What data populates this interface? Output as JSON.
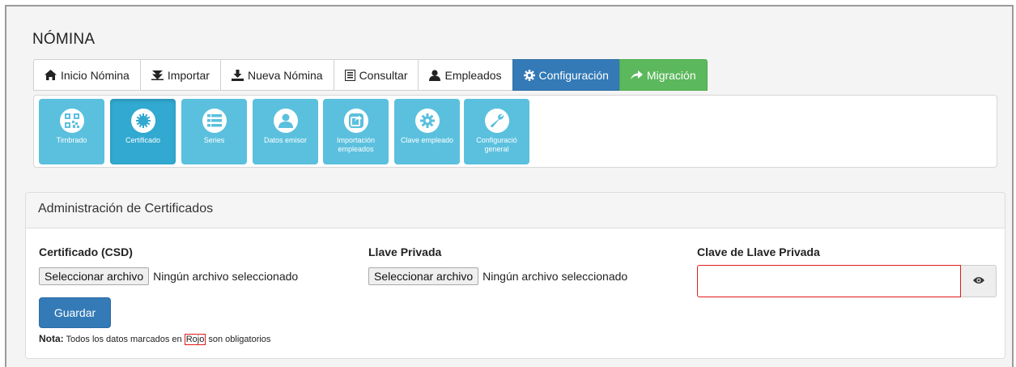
{
  "page": {
    "title": "NÓMINA"
  },
  "tabs": [
    {
      "label": "Inicio Nómina",
      "icon": "home-icon"
    },
    {
      "label": "Importar",
      "icon": "import-icon"
    },
    {
      "label": "Nueva Nómina",
      "icon": "download-icon"
    },
    {
      "label": "Consultar",
      "icon": "list-icon"
    },
    {
      "label": "Empleados",
      "icon": "user-icon"
    },
    {
      "label": "Configuración",
      "icon": "gear-icon",
      "active": true
    },
    {
      "label": "Migración",
      "icon": "arrow-right-icon"
    }
  ],
  "tiles": [
    {
      "label": "Timbrado",
      "icon": "qrcode-icon"
    },
    {
      "label": "Certificado",
      "icon": "certificate-icon",
      "active": true
    },
    {
      "label": "Series",
      "icon": "list-icon"
    },
    {
      "label": "Datos emisor",
      "icon": "user-icon"
    },
    {
      "label": "Importación empleados",
      "icon": "share-icon"
    },
    {
      "label": "Clave empleado",
      "icon": "gear-icon"
    },
    {
      "label": "Configuració general",
      "icon": "wrench-icon"
    }
  ],
  "cert_panel": {
    "heading": "Administración de Certificados",
    "certificado_label": "Certificado (CSD)",
    "llave_label": "Llave Privada",
    "clave_label": "Clave de Llave Privada",
    "file_button": "Seleccionar archivo",
    "no_file": "Ningún archivo seleccionado",
    "password_value": "",
    "save_button": "Guardar",
    "note_label": "Nota:",
    "note_before": "Todos los datos marcados en",
    "note_red": "Rojo",
    "note_after": "son obligatorios"
  },
  "colors": {
    "primary": "#337ab7",
    "success": "#5cb85c",
    "tile": "#5bc0de",
    "required": "#e21b1b"
  }
}
